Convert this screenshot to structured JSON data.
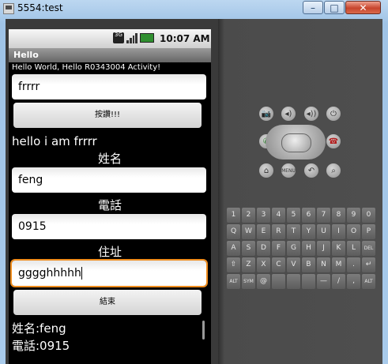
{
  "window": {
    "title": "5554:test",
    "minimize": "–",
    "maximize": "□",
    "close": "✕"
  },
  "statusbar": {
    "time": "10:07 AM",
    "network": "3G"
  },
  "app": {
    "title": "Hello",
    "subtitle": "Hello World, Hello R0343004 Activity!",
    "top_input": "frrrr",
    "press_button": "按讚!!!",
    "greeting": "hello i am frrrr",
    "name_label": "姓名",
    "name_value": "feng",
    "phone_label": "電話",
    "phone_value": "0915",
    "address_label": "住址",
    "address_value": "gggghhhhh",
    "end_button": "結束",
    "result_name": "姓名:feng",
    "result_phone": "電話:0915"
  },
  "keyboard": {
    "rows": [
      [
        "1",
        "2",
        "3",
        "4",
        "5",
        "6",
        "7",
        "8",
        "9",
        "0"
      ],
      [
        "Q",
        "W",
        "E",
        "R",
        "T",
        "Y",
        "U",
        "I",
        "O",
        "P"
      ],
      [
        "A",
        "S",
        "D",
        "F",
        "G",
        "H",
        "J",
        "K",
        "L",
        "DEL"
      ],
      [
        "⇧",
        "Z",
        "X",
        "C",
        "V",
        "B",
        "N",
        "M",
        ".",
        "↵"
      ],
      [
        "ALT",
        "SYM",
        "@",
        " ",
        " ",
        " ",
        "—",
        "/",
        ",",
        "ALT"
      ]
    ]
  },
  "controls": {
    "camera": "📷",
    "vol_down": "◂)",
    "vol_up": "◂))",
    "power": "⏻",
    "call": "✆",
    "end_call": "☎",
    "home": "⌂",
    "menu": "MENU",
    "back": "↶",
    "search": "⌕"
  }
}
